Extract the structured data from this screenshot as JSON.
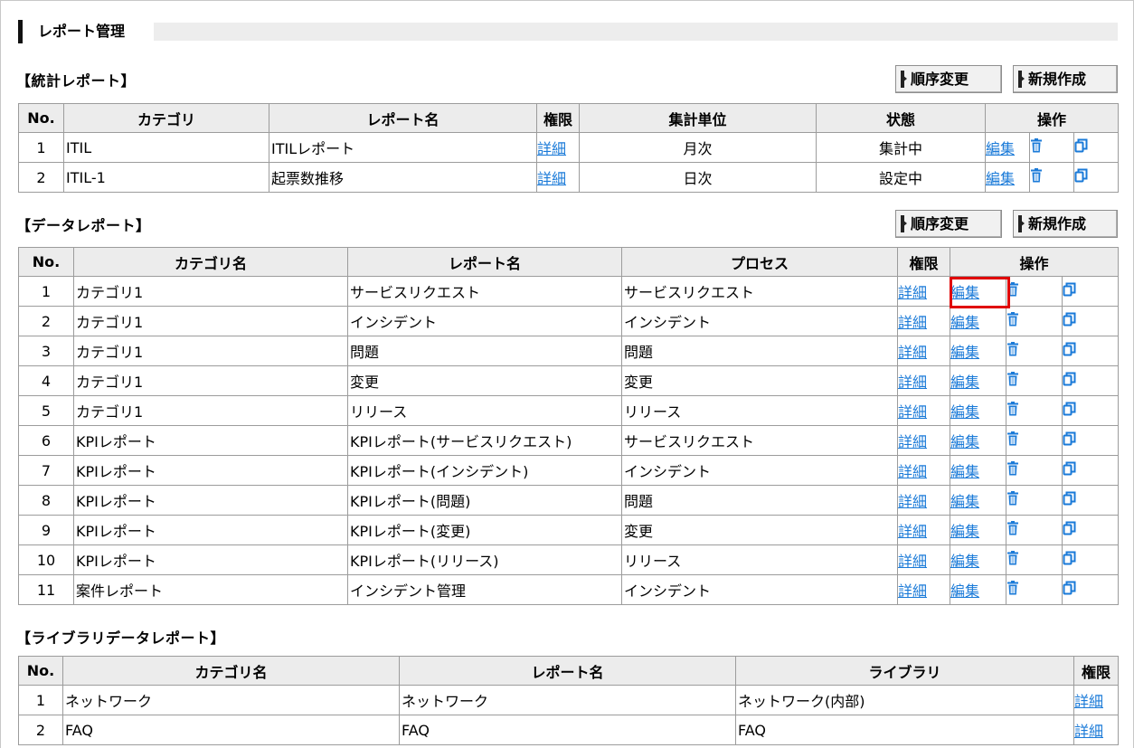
{
  "page": {
    "title": "レポート管理"
  },
  "stat": {
    "title": "【統計レポート】",
    "reorder_label": "順序変更",
    "create_label": "新規作成",
    "headers": [
      "No.",
      "カテゴリ",
      "レポート名",
      "権限",
      "集計単位",
      "状態",
      "操作"
    ],
    "rows": [
      {
        "no": "1",
        "category": "ITIL",
        "name": "ITILレポート",
        "perm": "詳細",
        "unit": "月次",
        "status": "集計中",
        "edit": "編集"
      },
      {
        "no": "2",
        "category": "ITIL-1",
        "name": "起票数推移",
        "perm": "詳細",
        "unit": "日次",
        "status": "設定中",
        "edit": "編集"
      }
    ]
  },
  "data": {
    "title": "【データレポート】",
    "reorder_label": "順序変更",
    "create_label": "新規作成",
    "headers": [
      "No.",
      "カテゴリ名",
      "レポート名",
      "プロセス",
      "権限",
      "操作"
    ],
    "rows": [
      {
        "no": "1",
        "category": "カテゴリ1",
        "name": "サービスリクエスト",
        "process": "サービスリクエスト",
        "perm": "詳細",
        "edit": "編集"
      },
      {
        "no": "2",
        "category": "カテゴリ1",
        "name": "インシデント",
        "process": "インシデント",
        "perm": "詳細",
        "edit": "編集"
      },
      {
        "no": "3",
        "category": "カテゴリ1",
        "name": "問題",
        "process": "問題",
        "perm": "詳細",
        "edit": "編集"
      },
      {
        "no": "4",
        "category": "カテゴリ1",
        "name": "変更",
        "process": "変更",
        "perm": "詳細",
        "edit": "編集"
      },
      {
        "no": "5",
        "category": "カテゴリ1",
        "name": "リリース",
        "process": "リリース",
        "perm": "詳細",
        "edit": "編集"
      },
      {
        "no": "6",
        "category": "KPIレポート",
        "name": "KPIレポート(サービスリクエスト)",
        "process": "サービスリクエスト",
        "perm": "詳細",
        "edit": "編集"
      },
      {
        "no": "7",
        "category": "KPIレポート",
        "name": "KPIレポート(インシデント)",
        "process": "インシデント",
        "perm": "詳細",
        "edit": "編集"
      },
      {
        "no": "8",
        "category": "KPIレポート",
        "name": "KPIレポート(問題)",
        "process": "問題",
        "perm": "詳細",
        "edit": "編集"
      },
      {
        "no": "9",
        "category": "KPIレポート",
        "name": "KPIレポート(変更)",
        "process": "変更",
        "perm": "詳細",
        "edit": "編集"
      },
      {
        "no": "10",
        "category": "KPIレポート",
        "name": "KPIレポート(リリース)",
        "process": "リリース",
        "perm": "詳細",
        "edit": "編集"
      },
      {
        "no": "11",
        "category": "案件レポート",
        "name": "インシデント管理",
        "process": "インシデント",
        "perm": "詳細",
        "edit": "編集"
      }
    ]
  },
  "library": {
    "title": "【ライブラリデータレポート】",
    "headers": [
      "No.",
      "カテゴリ名",
      "レポート名",
      "ライブラリ",
      "権限"
    ],
    "rows": [
      {
        "no": "1",
        "category": "ネットワーク",
        "name": "ネットワーク",
        "library": "ネットワーク(内部)",
        "perm": "詳細"
      },
      {
        "no": "2",
        "category": "FAQ",
        "name": "FAQ",
        "library": "FAQ",
        "perm": "詳細"
      }
    ]
  },
  "icons": {
    "delete": "trash-icon",
    "copy": "copy-icon"
  },
  "colors": {
    "link": "#1a7ad8",
    "header_bg": "#ececec",
    "border": "#9c9c9c",
    "highlight": "#e00000"
  }
}
